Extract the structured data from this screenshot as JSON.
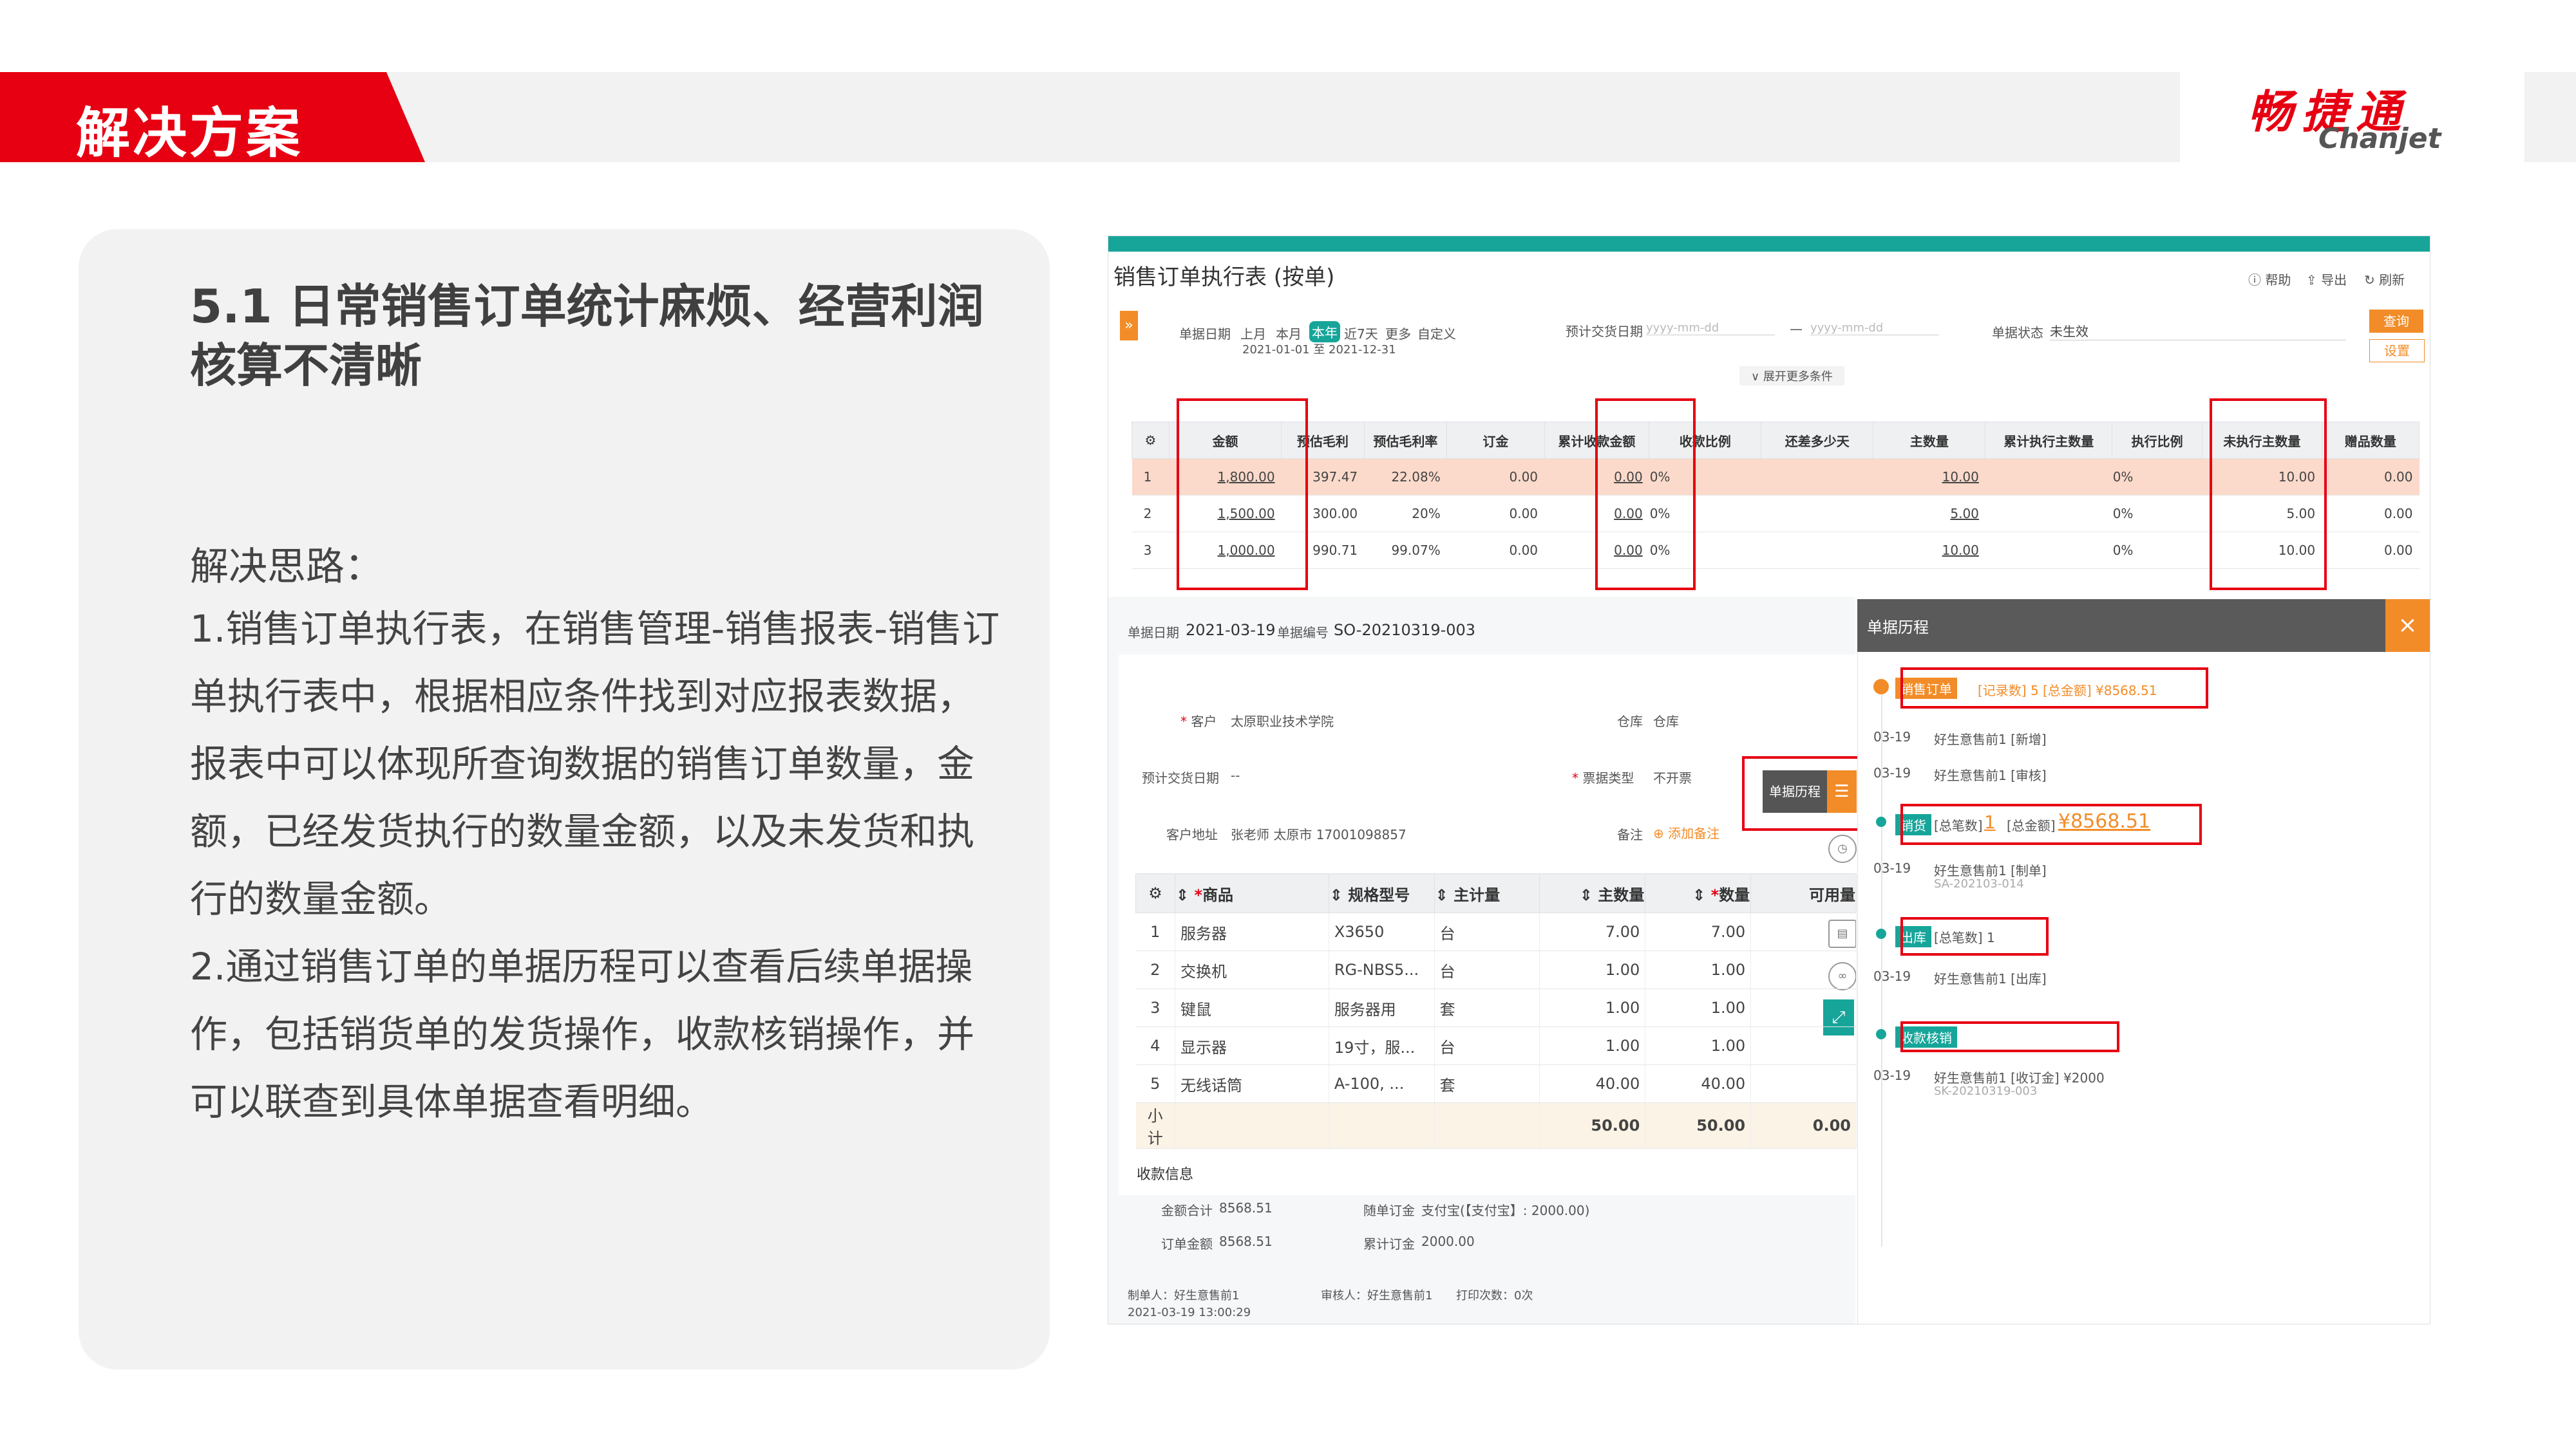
{
  "header": {
    "banner_title": "解决方案",
    "logo_cn": "畅捷通",
    "logo_en": "Chanjet"
  },
  "left": {
    "heading": "5.1 日常销售订单统计麻烦、经营利润核算不清晰",
    "approach_label": "解决思路：",
    "paragraph1": "1.销售订单执行表，在销售管理-销售报表-销售订单执行表中，根据相应条件找到对应报表数据，报表中可以体现所查询数据的销售订单数量，金额，已经发货执行的数量金额，以及未发货和执行的数量金额。",
    "paragraph2": "2.通过销售订单的单据历程可以查看后续单据操作，包括销货单的发货操作，收款核销操作，并可以联查到具体单据查看明细。"
  },
  "report": {
    "title": "销售订单执行表 (按单)",
    "toolbar": {
      "help": "帮助",
      "export": "导出",
      "refresh": "刷新"
    },
    "filters": {
      "doc_date_label": "单据日期",
      "periods": [
        "上月",
        "本月",
        "本年",
        "近7天",
        "更多",
        "自定义"
      ],
      "date_range": "2021-01-01 至 2021-12-31",
      "delivery_label": "预计交货日期",
      "delivery_from": "yyyy-mm-dd",
      "delivery_to": "yyyy-mm-dd",
      "dash": "—",
      "status_label": "单据状态",
      "status_value": "未生效",
      "expand": "展开更多条件",
      "query": "查询",
      "setup": "设置"
    },
    "columns": [
      "金额",
      "预估毛利",
      "预估毛利率",
      "订金",
      "累计收款金额",
      "收款比例",
      "还差多少天",
      "主数量",
      "累计执行主数量",
      "执行比例",
      "未执行主数量",
      "赠品数量"
    ],
    "rows": [
      {
        "no": "1",
        "cells": [
          "1,800.00",
          "397.47",
          "22.08%",
          "0.00",
          "0.00",
          "0%",
          "",
          "10.00",
          "",
          "0%",
          "10.00",
          "0.00"
        ]
      },
      {
        "no": "2",
        "cells": [
          "1,500.00",
          "300.00",
          "20%",
          "0.00",
          "0.00",
          "0%",
          "",
          "5.00",
          "",
          "0%",
          "5.00",
          "0.00"
        ]
      },
      {
        "no": "3",
        "cells": [
          "1,000.00",
          "990.71",
          "99.07%",
          "0.00",
          "0.00",
          "0%",
          "",
          "10.00",
          "",
          "0%",
          "10.00",
          "0.00"
        ]
      }
    ]
  },
  "detail": {
    "doc_date_label": "单据日期",
    "doc_date": "2021-03-19",
    "doc_no_label": "单据编号",
    "doc_no": "SO-20210319-003",
    "customer_label": "客户",
    "customer": "太原职业技术学院",
    "warehouse_label": "仓库",
    "warehouse": "仓库",
    "delivery_label": "预计交货日期",
    "delivery": "--",
    "invoice_label": "票据类型",
    "invoice": "不开票",
    "address_label": "客户地址",
    "address": "张老师 太原市 17001098857",
    "remark_label": "备注",
    "remark_link": "添加备注",
    "history_button": "单据历程",
    "item_columns": [
      "商品",
      "规格型号",
      "主计量",
      "主数量",
      "数量",
      "可用量"
    ],
    "items": [
      [
        "1",
        "服务器",
        "X3650",
        "台",
        "7.00",
        "7.00",
        ""
      ],
      [
        "2",
        "交换机",
        "RG-NBS5...",
        "台",
        "1.00",
        "1.00",
        ""
      ],
      [
        "3",
        "键鼠",
        "服务器用",
        "套",
        "1.00",
        "1.00",
        ""
      ],
      [
        "4",
        "显示器",
        "19寸，服...",
        "台",
        "1.00",
        "1.00",
        ""
      ],
      [
        "5",
        "无线话筒",
        "A-100, ...",
        "套",
        "40.00",
        "40.00",
        ""
      ]
    ],
    "subtotal": {
      "label": "小计",
      "main_qty": "50.00",
      "qty": "50.00",
      "avail": "0.00"
    },
    "receipt": {
      "title": "收款信息",
      "total_label": "金额合计",
      "total": "8568.51",
      "order_label": "订单金额",
      "order": "8568.51",
      "deposit_label": "随单订金",
      "deposit": "支付宝(【支付宝】: 2000.00)",
      "accum_label": "累计订金",
      "accum": "2000.00"
    },
    "footer": {
      "maker": "制单人：好生意售前1",
      "reviewer": "审核人：好生意售前1",
      "prints": "打印次数：0次",
      "time": "2021-03-19 13:00:29"
    }
  },
  "history": {
    "title": "单据历程",
    "close": "×",
    "stage1": {
      "tag": "销售订单",
      "info": "[记录数] 5  [总金额] ¥8568.51"
    },
    "entries1": [
      {
        "date": "03-19",
        "text": "好生意售前1 [新增]"
      },
      {
        "date": "03-19",
        "text": "好生意售前1 [审核]"
      }
    ],
    "stage2": {
      "tag": "销货",
      "info": "[总笔数]",
      "count": "1",
      "amount_label": "[总金额]",
      "amount": "¥8568.51"
    },
    "entry2": {
      "date": "03-19",
      "text": "好生意售前1 [制单]",
      "sub": "SA-202103-014"
    },
    "stage3": {
      "tag": "出库",
      "info": "[总笔数] 1"
    },
    "entry3": {
      "date": "03-19",
      "text": "好生意售前1 [出库]"
    },
    "stage4": {
      "tag": "收款核销"
    },
    "entry4": {
      "date": "03-19",
      "text": "好生意售前1 [收订金] ¥2000",
      "sub": "SK-20210319-003"
    }
  }
}
